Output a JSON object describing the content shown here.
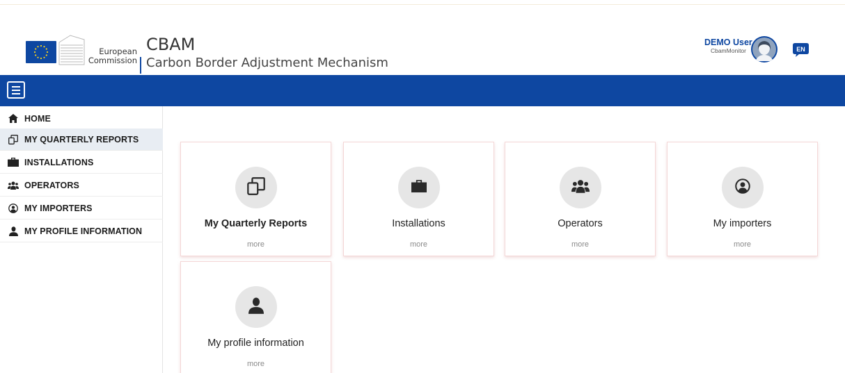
{
  "header": {
    "org_line1": "European",
    "org_line2": "Commission",
    "app_title": "CBAM",
    "app_subtitle": "Carbon Border Adjustment Mechanism",
    "user_name": "DEMO User",
    "user_role": "CbamMonitor",
    "language": "EN"
  },
  "colors": {
    "brand_blue": "#0e47a1",
    "active_nav_bg": "#e8edf3",
    "card_border": "#f4d7d7",
    "icon_circle": "#e6e6e6"
  },
  "sidebar": {
    "items": [
      {
        "label": "HOME",
        "icon": "home-icon"
      },
      {
        "label": "MY QUARTERLY REPORTS",
        "icon": "reports-icon",
        "active": true
      },
      {
        "label": "INSTALLATIONS",
        "icon": "briefcase-icon"
      },
      {
        "label": "OPERATORS",
        "icon": "users-icon"
      },
      {
        "label": "MY IMPORTERS",
        "icon": "user-circle-icon"
      },
      {
        "label": "MY PROFILE INFORMATION",
        "icon": "user-icon"
      }
    ]
  },
  "cards": [
    {
      "title": "My Quarterly Reports",
      "more": "more",
      "icon": "reports-icon"
    },
    {
      "title": "Installations",
      "more": "more",
      "icon": "briefcase-icon"
    },
    {
      "title": "Operators",
      "more": "more",
      "icon": "users-icon"
    },
    {
      "title": "My importers",
      "more": "more",
      "icon": "user-circle-icon"
    },
    {
      "title": "My profile information",
      "more": "more",
      "icon": "user-icon"
    }
  ]
}
